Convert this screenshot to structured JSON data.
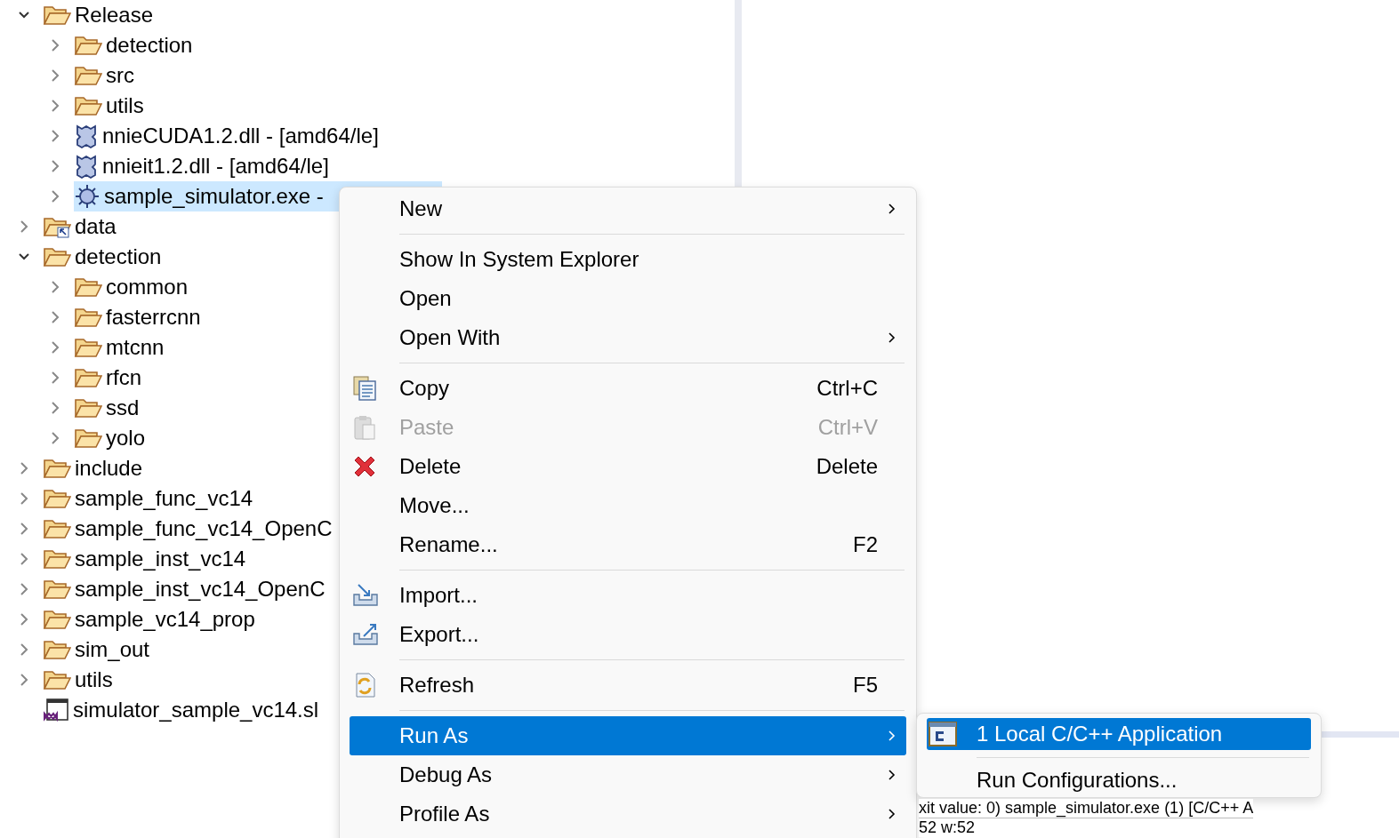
{
  "tree": [
    {
      "label": "Release",
      "kind": "folder",
      "expanded": true,
      "selected": false,
      "children": [
        {
          "label": "detection",
          "kind": "folder",
          "expanded": false,
          "selected": false
        },
        {
          "label": "src",
          "kind": "folder",
          "expanded": false,
          "selected": false
        },
        {
          "label": "utils",
          "kind": "folder",
          "expanded": false,
          "selected": false
        },
        {
          "label": "nnieCUDA1.2.dll - [amd64/le]",
          "kind": "library",
          "expanded": false,
          "selected": false
        },
        {
          "label": "nnieit1.2.dll - [amd64/le]",
          "kind": "library",
          "expanded": false,
          "selected": false
        },
        {
          "label": "sample_simulator.exe -",
          "kind": "executable",
          "expanded": false,
          "selected": true
        }
      ]
    },
    {
      "label": "data",
      "kind": "linked-folder",
      "expanded": false,
      "selected": false
    },
    {
      "label": "detection",
      "kind": "folder",
      "expanded": true,
      "selected": false,
      "children": [
        {
          "label": "common",
          "kind": "folder",
          "expanded": false,
          "selected": false
        },
        {
          "label": "fasterrcnn",
          "kind": "folder",
          "expanded": false,
          "selected": false
        },
        {
          "label": "mtcnn",
          "kind": "folder",
          "expanded": false,
          "selected": false
        },
        {
          "label": "rfcn",
          "kind": "folder",
          "expanded": false,
          "selected": false
        },
        {
          "label": "ssd",
          "kind": "folder",
          "expanded": false,
          "selected": false
        },
        {
          "label": "yolo",
          "kind": "folder",
          "expanded": false,
          "selected": false
        }
      ]
    },
    {
      "label": "include",
      "kind": "folder",
      "expanded": false,
      "selected": false
    },
    {
      "label": "sample_func_vc14",
      "kind": "folder",
      "expanded": false,
      "selected": false
    },
    {
      "label": "sample_func_vc14_OpenC",
      "kind": "folder",
      "expanded": false,
      "selected": false
    },
    {
      "label": "sample_inst_vc14",
      "kind": "folder",
      "expanded": false,
      "selected": false
    },
    {
      "label": "sample_inst_vc14_OpenC",
      "kind": "folder",
      "expanded": false,
      "selected": false
    },
    {
      "label": "sample_vc14_prop",
      "kind": "folder",
      "expanded": false,
      "selected": false
    },
    {
      "label": "sim_out",
      "kind": "folder",
      "expanded": false,
      "selected": false
    },
    {
      "label": "utils",
      "kind": "folder",
      "expanded": false,
      "selected": false
    },
    {
      "label": "simulator_sample_vc14.sl",
      "kind": "solution",
      "selected": false
    }
  ],
  "context_menu": [
    {
      "kind": "item",
      "label": "New",
      "submenu": true,
      "selected": false,
      "disabled": false
    },
    {
      "kind": "separator"
    },
    {
      "kind": "item",
      "label": "Show In System Explorer",
      "submenu": false,
      "selected": false,
      "disabled": false
    },
    {
      "kind": "item",
      "label": "Open",
      "submenu": false,
      "selected": false,
      "disabled": false
    },
    {
      "kind": "item",
      "label": "Open With",
      "submenu": true,
      "selected": false,
      "disabled": false
    },
    {
      "kind": "separator"
    },
    {
      "kind": "item",
      "label": "Copy",
      "shortcut": "Ctrl+C",
      "submenu": false,
      "selected": false,
      "disabled": false
    },
    {
      "kind": "item",
      "label": "Paste",
      "shortcut": "Ctrl+V",
      "submenu": false,
      "selected": false,
      "disabled": true
    },
    {
      "kind": "item",
      "label": "Delete",
      "shortcut": "Delete",
      "submenu": false,
      "selected": false,
      "disabled": false
    },
    {
      "kind": "item",
      "label": "Move...",
      "submenu": false,
      "selected": false,
      "disabled": false
    },
    {
      "kind": "item",
      "label": "Rename...",
      "shortcut": "F2",
      "submenu": false,
      "selected": false,
      "disabled": false
    },
    {
      "kind": "separator"
    },
    {
      "kind": "item",
      "label": "Import...",
      "submenu": false,
      "selected": false,
      "disabled": false
    },
    {
      "kind": "item",
      "label": "Export...",
      "submenu": false,
      "selected": false,
      "disabled": false
    },
    {
      "kind": "separator"
    },
    {
      "kind": "item",
      "label": "Refresh",
      "shortcut": "F5",
      "submenu": false,
      "selected": false,
      "disabled": false
    },
    {
      "kind": "separator"
    },
    {
      "kind": "item",
      "label": "Run As",
      "submenu": true,
      "selected": true,
      "disabled": false
    },
    {
      "kind": "item",
      "label": "Debug As",
      "submenu": true,
      "selected": false,
      "disabled": false
    },
    {
      "kind": "item",
      "label": "Profile As",
      "submenu": true,
      "selected": false,
      "disabled": false
    }
  ],
  "submenu": [
    {
      "kind": "item",
      "label": "1 Local C/C++ Application",
      "selected": true
    },
    {
      "kind": "separator"
    },
    {
      "kind": "item",
      "label": "Run Configurations...",
      "selected": false
    }
  ],
  "console": {
    "lines": [
      "xit value: 0) sample_simulator.exe (1) [C/C++ A",
      "52   w:52"
    ]
  }
}
